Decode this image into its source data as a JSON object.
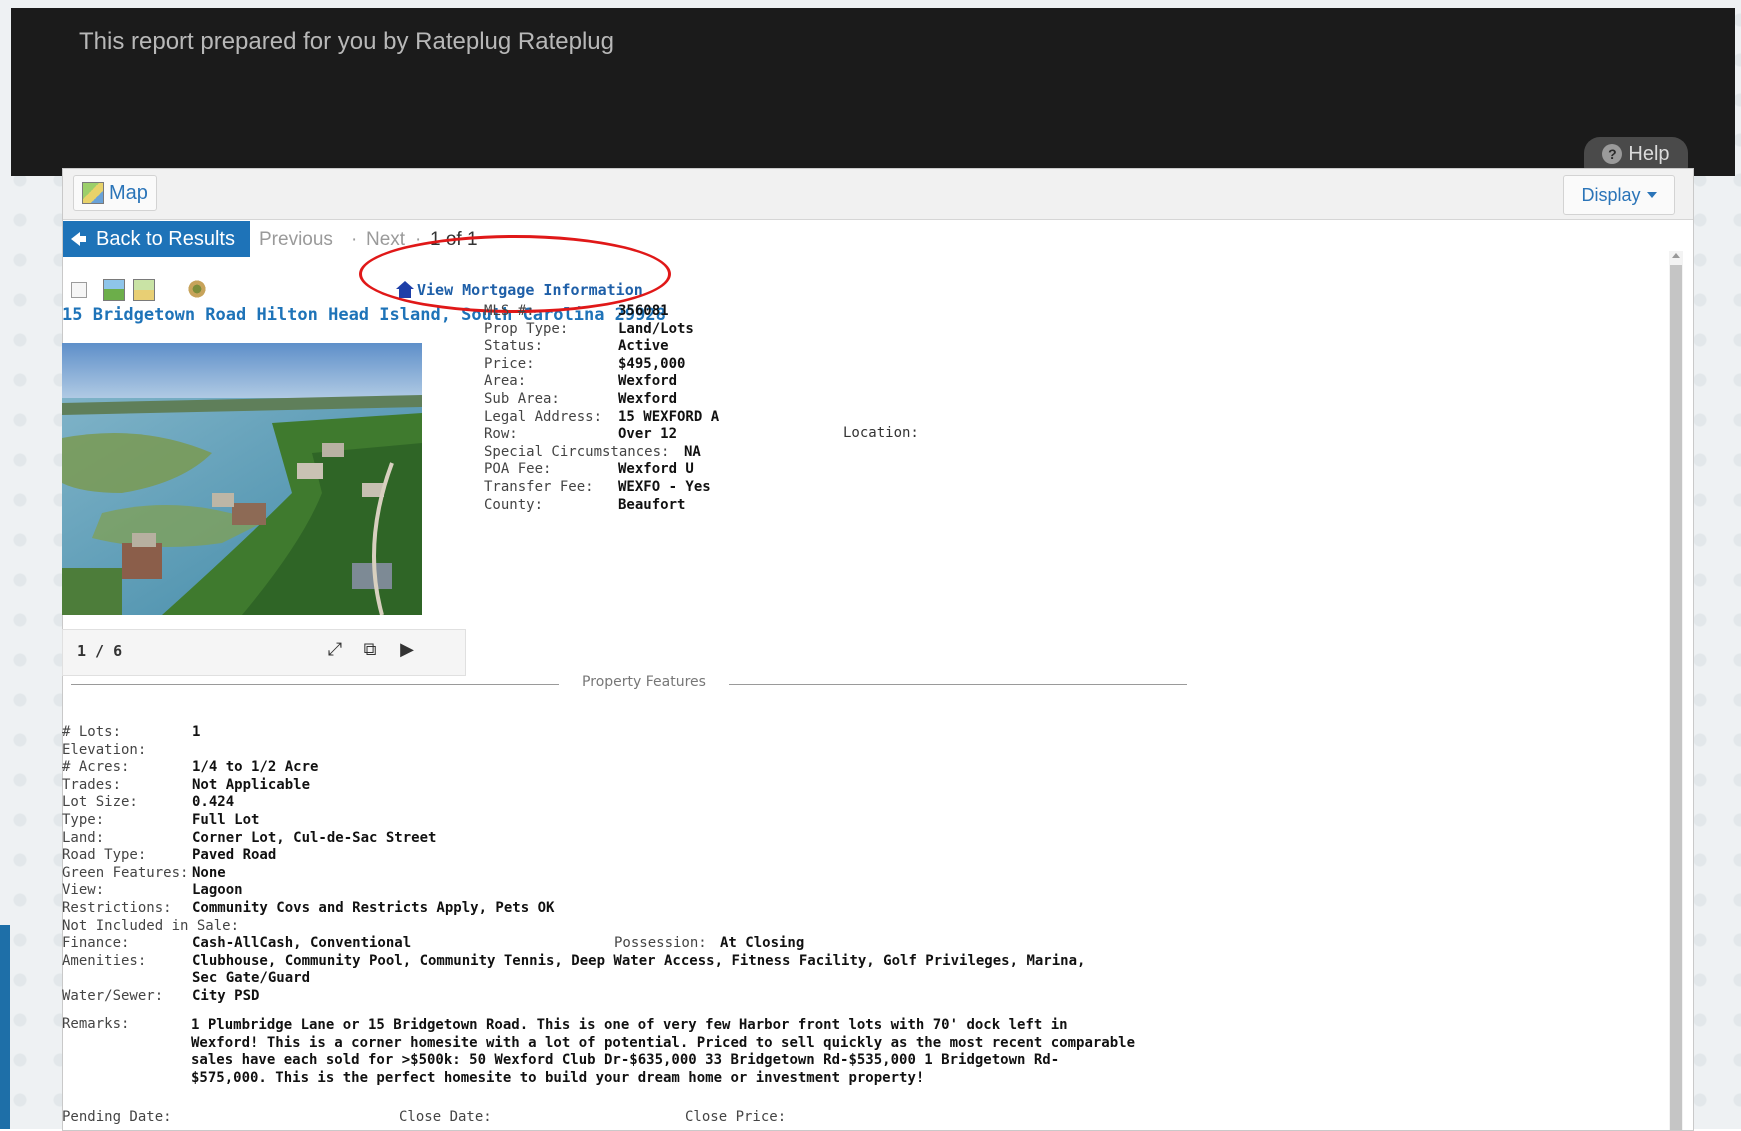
{
  "header": {
    "title": "This report prepared for you by Rateplug Rateplug",
    "help_label": "Help"
  },
  "toolbar": {
    "map_label": "Map",
    "display_label": "Display"
  },
  "nav": {
    "back_label": "Back to Results",
    "previous_label": "Previous",
    "sep": "·",
    "next_label": "Next",
    "count_label": "1 of 1"
  },
  "listing": {
    "mortgage_link": "View Mortgage Information",
    "title": "15 Bridgetown Road Hilton Head Island, South Carolina 29928",
    "photo_counter": "1 / 6",
    "details": [
      {
        "label": "MLS #:",
        "value": "356081"
      },
      {
        "label": "Prop Type:",
        "value": "Land/Lots"
      },
      {
        "label": "Status:",
        "value": "Active"
      },
      {
        "label": "Price:",
        "value": "$495,000"
      },
      {
        "label": "Area:",
        "value": "Wexford"
      },
      {
        "label": "Sub Area:",
        "value": "Wexford"
      },
      {
        "label": "Legal Address:",
        "value": "15 WEXFORD A"
      },
      {
        "label": "Row:",
        "value": "Over 12"
      },
      {
        "label": "Special Circumstances:",
        "value": "NA"
      },
      {
        "label": "POA Fee:",
        "value": "Wexford U"
      },
      {
        "label": "Transfer Fee:",
        "value": "WEXFO - Yes"
      },
      {
        "label": "County:",
        "value": "Beaufort"
      }
    ],
    "location_label": "Location:"
  },
  "features": {
    "section_title": "Property Features",
    "rows": [
      {
        "label": "# Lots:",
        "value": "1"
      },
      {
        "label": "Elevation:",
        "value": ""
      },
      {
        "label": "# Acres:",
        "value": "1/4 to 1/2 Acre"
      },
      {
        "label": "Trades:",
        "value": "Not Applicable"
      },
      {
        "label": "Lot Size:",
        "value": "0.424"
      },
      {
        "label": "Type:",
        "value": "Full Lot"
      },
      {
        "label": "Land:",
        "value": "Corner Lot, Cul-de-Sac Street"
      },
      {
        "label": "Road Type:",
        "value": "Paved Road"
      },
      {
        "label": "Green Features:",
        "value": "None"
      },
      {
        "label": "View:",
        "value": "Lagoon"
      },
      {
        "label": "Restrictions:",
        "value": "Community Covs and Restricts Apply, Pets OK"
      },
      {
        "label": "Not Included in Sale:",
        "value": ""
      },
      {
        "label": "Finance:",
        "value": "Cash-AllCash, Conventional"
      },
      {
        "label": "Amenities:",
        "value": "Clubhouse, Community Pool, Community Tennis, Deep Water Access, Fitness Facility, Golf Privileges, Marina,"
      },
      {
        "label": "",
        "value": "Sec Gate/Guard"
      },
      {
        "label": "Water/Sewer:",
        "value": "City PSD"
      }
    ],
    "possession_label": "Possession:",
    "possession_value": "At Closing",
    "remarks_label": "Remarks:",
    "remarks_text": "1 Plumbridge Lane or 15 Bridgetown Road. This is one of very few Harbor front lots with 70' dock left in\nWexford! This is a corner homesite with a lot of potential. Priced to sell quickly as the most recent comparable\nsales have each sold for >$500k: 50 Wexford Club Dr-$635,000 33 Bridgetown Rd-$535,000 1 Bridgetown Rd-\n$575,000. This is the perfect homesite to build your dream home or investment property!",
    "pending_date_label": "Pending Date:",
    "close_date_label": "Close Date:",
    "close_price_label": "Close Price:"
  }
}
